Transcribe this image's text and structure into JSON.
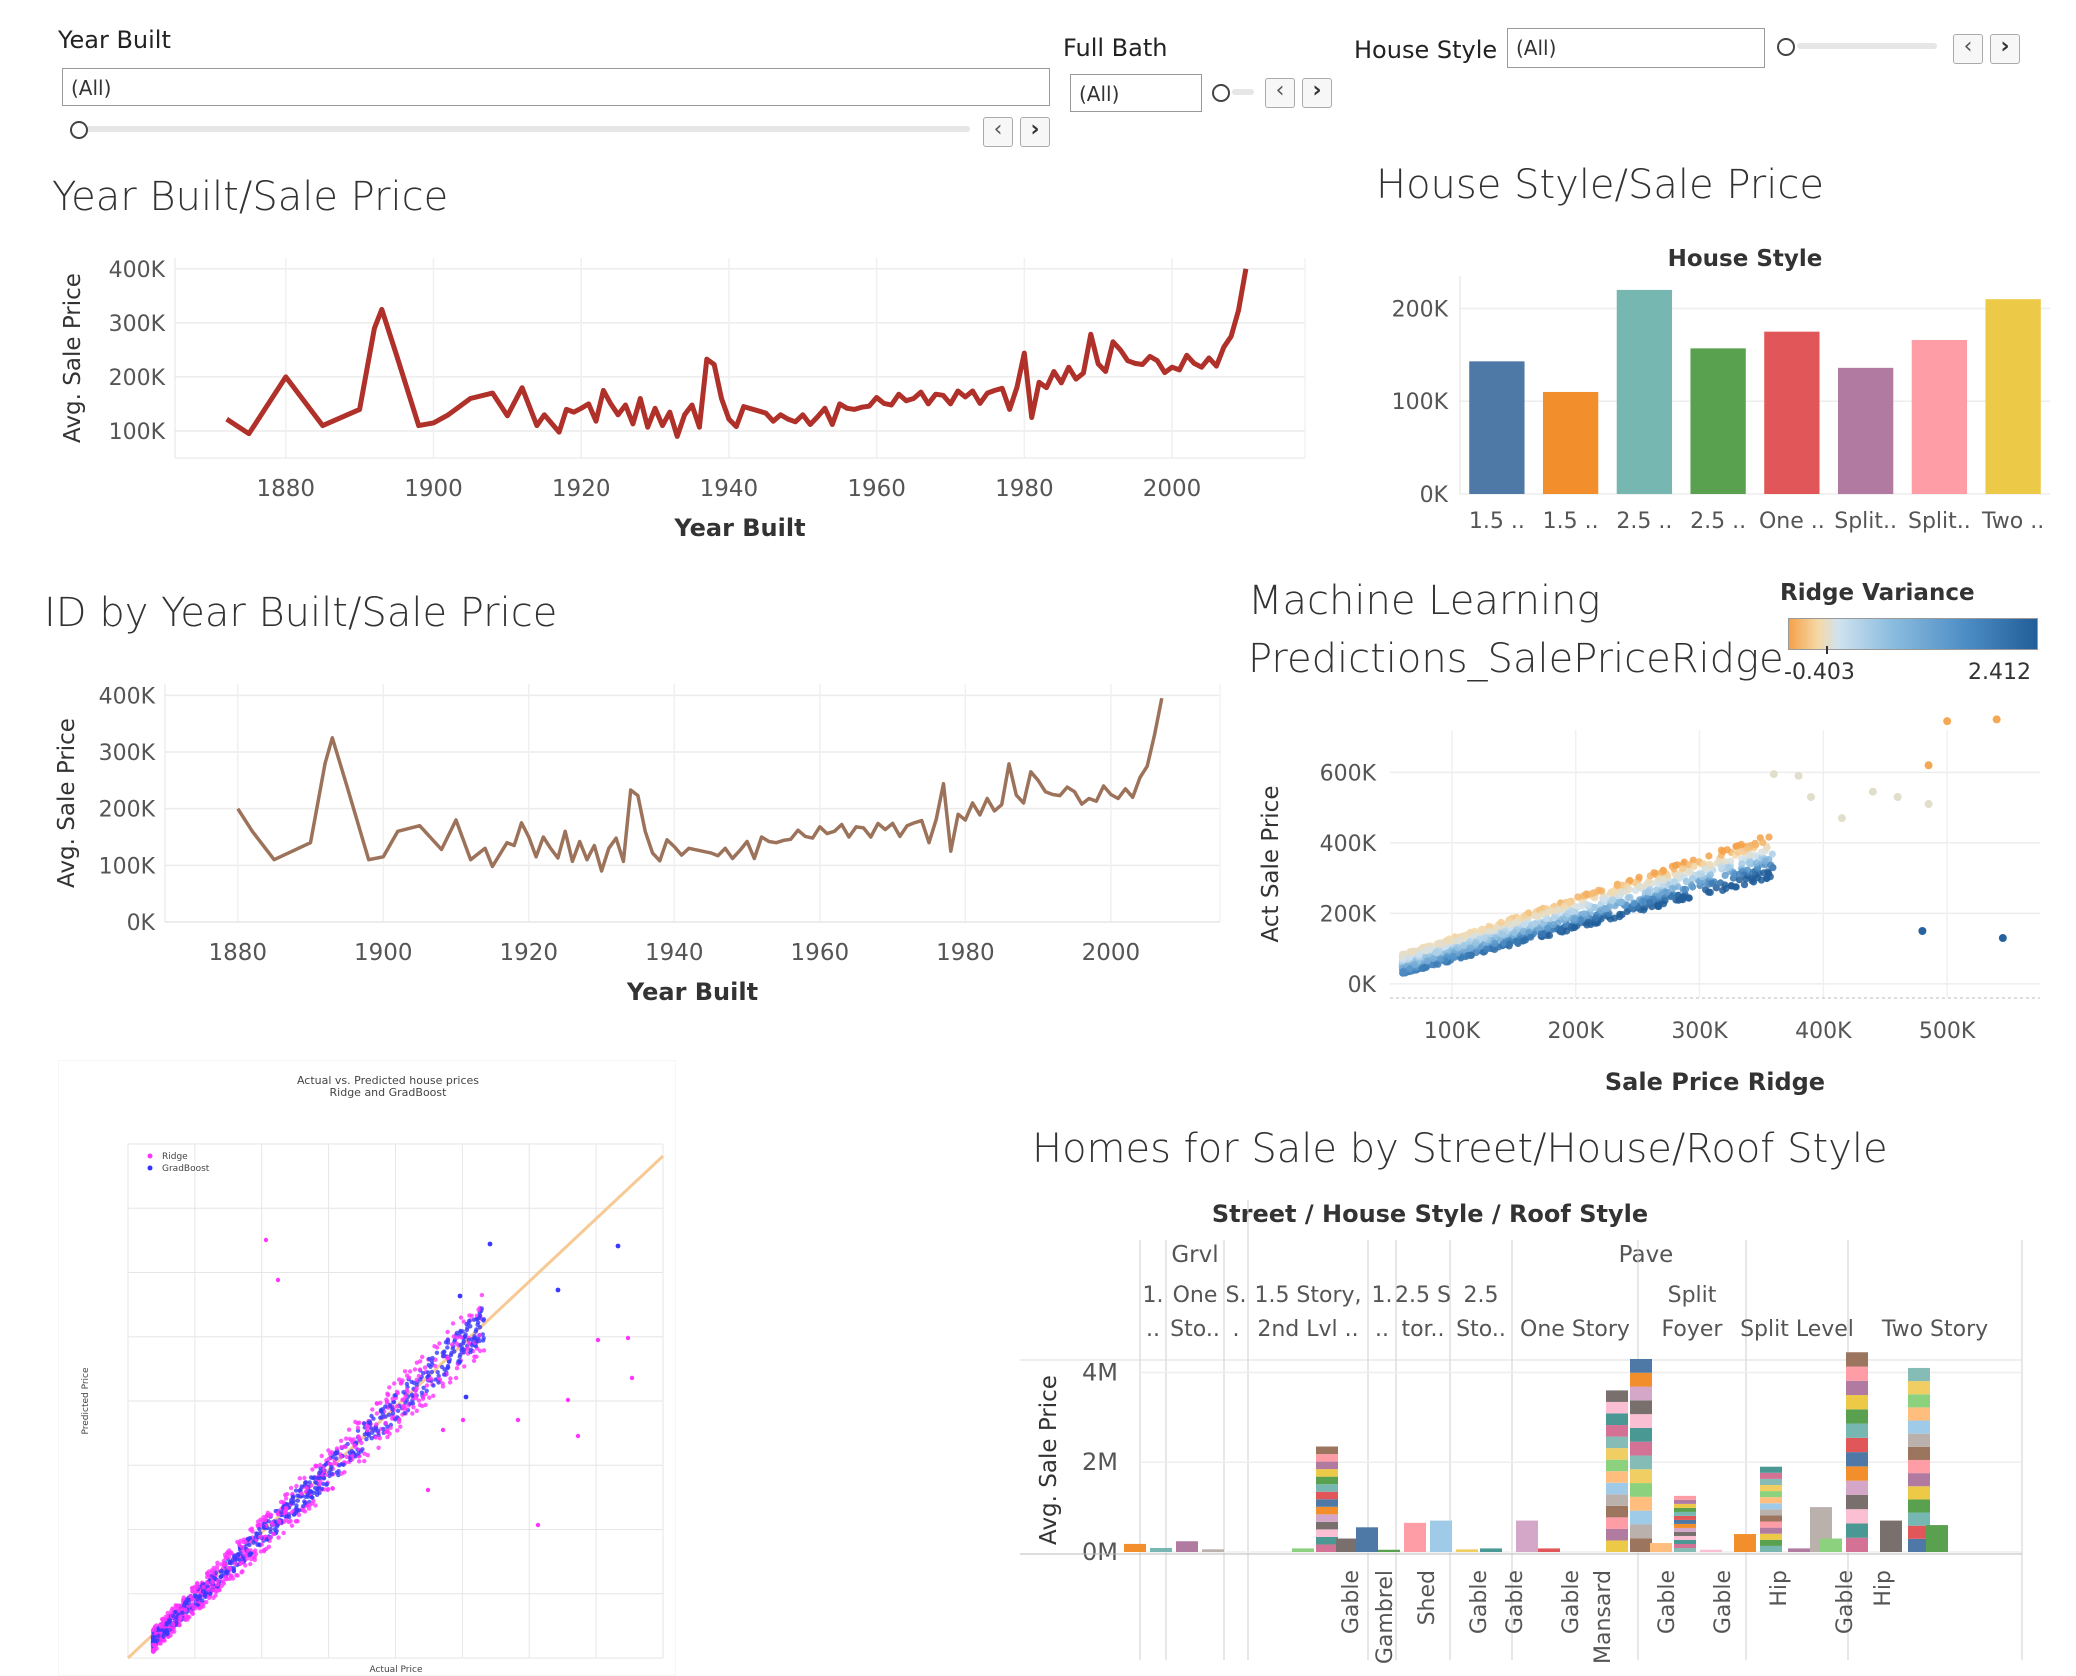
{
  "filters": {
    "year_built": {
      "label": "Year Built",
      "value": "(All)"
    },
    "full_bath": {
      "label": "Full Bath",
      "value": "(All)"
    },
    "house_style": {
      "label": "House Style",
      "value": "(All)"
    }
  },
  "colors": {
    "line1": "#b0302a",
    "line2": "#9c735a",
    "ridge_low": "#f4a24a",
    "ridge_high": "#215e9a"
  },
  "charts": {
    "year_built_sale_price": {
      "title": "Year Built/Sale Price"
    },
    "house_style_sale_price": {
      "title": "House Style/Sale Price"
    },
    "id_by_year": {
      "title": "ID by Year Built/Sale Price"
    },
    "ml_predictions": {
      "title_line1": "Machine Learning",
      "title_line2": "Predictions_SalePriceRidge",
      "legend_title": "Ridge Variance",
      "legend_min": "-0.403",
      "legend_max": "2.412"
    },
    "homes_for_sale": {
      "title": "Homes for Sale by Street/House/Roof Style"
    }
  },
  "chart_data": [
    {
      "type": "line",
      "title": "",
      "xlabel": "Year Built",
      "ylabel": "Avg. Sale Price",
      "x_ticks": [
        "1880",
        "1900",
        "1920",
        "1940",
        "1960",
        "1980",
        "2000"
      ],
      "y_ticks": [
        "100K",
        "200K",
        "300K",
        "400K"
      ],
      "xlim": [
        1865,
        2018
      ],
      "ylim": [
        50000,
        420000
      ],
      "x": [
        1872,
        1875,
        1880,
        1885,
        1890,
        1892,
        1893,
        1895,
        1898,
        1900,
        1902,
        1905,
        1908,
        1910,
        1912,
        1914,
        1915,
        1917,
        1918,
        1919,
        1920,
        1921,
        1922,
        1923,
        1924,
        1925,
        1926,
        1927,
        1928,
        1929,
        1930,
        1931,
        1932,
        1933,
        1934,
        1935,
        1936,
        1937,
        1938,
        1939,
        1940,
        1941,
        1942,
        1945,
        1946,
        1947,
        1948,
        1949,
        1950,
        1951,
        1952,
        1953,
        1954,
        1955,
        1956,
        1957,
        1958,
        1959,
        1960,
        1961,
        1962,
        1963,
        1964,
        1965,
        1966,
        1967,
        1968,
        1969,
        1970,
        1971,
        1972,
        1973,
        1974,
        1975,
        1976,
        1977,
        1978,
        1979,
        1980,
        1981,
        1982,
        1983,
        1984,
        1985,
        1986,
        1987,
        1988,
        1989,
        1990,
        1991,
        1992,
        1993,
        1994,
        1995,
        1996,
        1997,
        1998,
        1999,
        2000,
        2001,
        2002,
        2003,
        2004,
        2005,
        2006,
        2007,
        2008,
        2009,
        2010
      ],
      "y": [
        122000,
        95000,
        200000,
        110000,
        140000,
        290000,
        325000,
        240000,
        110000,
        115000,
        130000,
        160000,
        170000,
        128000,
        180000,
        110000,
        130000,
        98000,
        140000,
        135000,
        142000,
        150000,
        118000,
        175000,
        150000,
        130000,
        148000,
        113000,
        160000,
        107000,
        142000,
        110000,
        135000,
        90000,
        130000,
        148000,
        107000,
        233000,
        223000,
        160000,
        122000,
        108000,
        145000,
        133000,
        118000,
        130000,
        122000,
        117000,
        130000,
        112000,
        126000,
        142000,
        112000,
        150000,
        142000,
        140000,
        144000,
        146000,
        162000,
        151000,
        148000,
        168000,
        156000,
        160000,
        172000,
        150000,
        168000,
        166000,
        150000,
        174000,
        163000,
        174000,
        151000,
        170000,
        175000,
        179000,
        140000,
        181000,
        244000,
        125000,
        190000,
        180000,
        210000,
        189000,
        218000,
        196000,
        207000,
        279000,
        224000,
        210000,
        265000,
        250000,
        230000,
        225000,
        223000,
        238000,
        230000,
        208000,
        218000,
        213000,
        240000,
        225000,
        218000,
        235000,
        220000,
        255000,
        275000,
        323000,
        400000
      ]
    },
    {
      "type": "bar",
      "title": "House Style",
      "categories": [
        "1.5 ..",
        "1.5 ..",
        "2.5 ..",
        "2.5 ..",
        "One ..",
        "Split..",
        "Split..",
        "Two .."
      ],
      "values": [
        143000,
        110000,
        220000,
        157000,
        175000,
        136000,
        166000,
        210000
      ],
      "colors": [
        "#4e79a7",
        "#f28e2b",
        "#76b7b2",
        "#59a14f",
        "#e15759",
        "#b07aa1",
        "#ff9da7",
        "#edc948"
      ],
      "y_ticks": [
        "0K",
        "100K",
        "200K"
      ],
      "ylim": [
        0,
        235000
      ]
    },
    {
      "type": "line",
      "title": "",
      "xlabel": "Year Built",
      "ylabel": "Avg. Sale Price",
      "x_ticks": [
        "1880",
        "1900",
        "1920",
        "1940",
        "1960",
        "1980",
        "2000"
      ],
      "y_ticks": [
        "0K",
        "100K",
        "200K",
        "300K",
        "400K"
      ],
      "xlim": [
        1870,
        2015
      ],
      "ylim": [
        0,
        420000
      ],
      "x": [
        1880,
        1882,
        1885,
        1890,
        1892,
        1893,
        1895,
        1898,
        1900,
        1902,
        1905,
        1908,
        1910,
        1912,
        1914,
        1915,
        1917,
        1918,
        1919,
        1920,
        1921,
        1922,
        1923,
        1924,
        1925,
        1926,
        1927,
        1928,
        1929,
        1930,
        1931,
        1932,
        1933,
        1934,
        1935,
        1936,
        1937,
        1938,
        1939,
        1940,
        1941,
        1942,
        1945,
        1946,
        1947,
        1948,
        1949,
        1950,
        1951,
        1952,
        1953,
        1954,
        1955,
        1956,
        1957,
        1958,
        1959,
        1960,
        1961,
        1962,
        1963,
        1964,
        1965,
        1966,
        1967,
        1968,
        1969,
        1970,
        1971,
        1972,
        1973,
        1974,
        1975,
        1976,
        1977,
        1978,
        1979,
        1980,
        1981,
        1982,
        1983,
        1984,
        1985,
        1986,
        1987,
        1988,
        1989,
        1990,
        1991,
        1992,
        1993,
        1994,
        1995,
        1996,
        1997,
        1998,
        1999,
        2000,
        2001,
        2002,
        2003,
        2004,
        2005,
        2006,
        2007,
        2008,
        2009,
        2010
      ],
      "y": [
        200000,
        160000,
        110000,
        140000,
        280000,
        325000,
        240000,
        110000,
        115000,
        160000,
        170000,
        128000,
        180000,
        110000,
        130000,
        98000,
        140000,
        135000,
        175000,
        150000,
        115000,
        150000,
        130000,
        113000,
        160000,
        107000,
        142000,
        110000,
        135000,
        90000,
        130000,
        148000,
        107000,
        233000,
        223000,
        160000,
        122000,
        108000,
        145000,
        133000,
        118000,
        130000,
        122000,
        117000,
        130000,
        112000,
        126000,
        142000,
        112000,
        150000,
        142000,
        140000,
        144000,
        146000,
        162000,
        151000,
        148000,
        168000,
        156000,
        160000,
        172000,
        150000,
        168000,
        166000,
        150000,
        174000,
        163000,
        174000,
        151000,
        170000,
        175000,
        179000,
        140000,
        181000,
        244000,
        125000,
        190000,
        180000,
        210000,
        189000,
        218000,
        196000,
        207000,
        279000,
        224000,
        210000,
        265000,
        250000,
        230000,
        225000,
        223000,
        238000,
        230000,
        208000,
        218000,
        213000,
        240000,
        225000,
        218000,
        235000,
        220000,
        255000,
        275000,
        330000,
        395000
      ]
    },
    {
      "type": "scatter",
      "title": "",
      "xlabel": "Sale Price Ridge",
      "ylabel": "Act Sale Price",
      "x_ticks": [
        "100K",
        "200K",
        "300K",
        "400K",
        "500K"
      ],
      "y_ticks": [
        "0K",
        "200K",
        "400K",
        "600K"
      ],
      "xlim": [
        50000,
        575000
      ],
      "ylim": [
        -40000,
        720000
      ],
      "color_scale": {
        "name": "Ridge Variance",
        "min": -0.403,
        "max": 2.412
      },
      "outliers": [
        {
          "x": 500000,
          "y": 745000
        },
        {
          "x": 540000,
          "y": 750000
        },
        {
          "x": 485000,
          "y": 620000
        },
        {
          "x": 440000,
          "y": 545000
        },
        {
          "x": 460000,
          "y": 530000
        },
        {
          "x": 485000,
          "y": 510000
        },
        {
          "x": 360000,
          "y": 595000
        },
        {
          "x": 380000,
          "y": 590000
        },
        {
          "x": 390000,
          "y": 530000
        },
        {
          "x": 415000,
          "y": 470000
        },
        {
          "x": 480000,
          "y": 150000
        },
        {
          "x": 545000,
          "y": 130000
        }
      ]
    },
    {
      "type": "bar",
      "title": "Street / House Style / Roof Style",
      "ylabel": "Avg. Sale Price",
      "y_ticks": [
        "0M",
        "2M",
        "4M"
      ],
      "ylim": [
        0,
        4500000
      ],
      "street": [
        "Grvl",
        "Pave"
      ],
      "house_style_headers": [
        "1. ..",
        "One Sto..",
        "S. .",
        "1.5 Story, 2nd Lvl ..",
        "1. ..",
        "2.5 S tor..",
        "2.5 Sto..",
        "One Story",
        "Split Foyer",
        "Split Level",
        "Two Story"
      ],
      "roof_labels": [
        "Gable",
        "Gambrel",
        "Shed",
        "Gable",
        "Gable",
        "Gable",
        "Mansard",
        "Gable",
        "Gable",
        "Hip",
        "Gable",
        "Hip"
      ],
      "stacked_totals": [
        180000,
        90000,
        240000,
        60000,
        80000,
        2350000,
        300000,
        550000,
        50000,
        650000,
        700000,
        60000,
        80000,
        700000,
        80000,
        3600000,
        4300000,
        200000,
        1250000,
        50000,
        400000,
        1900000,
        80000,
        1000000,
        300000,
        4450000,
        700000,
        4100000,
        600000
      ]
    },
    {
      "type": "scatter",
      "title": "Actual vs. Predicted house prices\nRidge and GradBoost",
      "xlabel": "Actual Price",
      "ylabel": "Predicted Price",
      "series": [
        {
          "name": "Ridge"
        },
        {
          "name": "GradBoost"
        }
      ]
    }
  ]
}
